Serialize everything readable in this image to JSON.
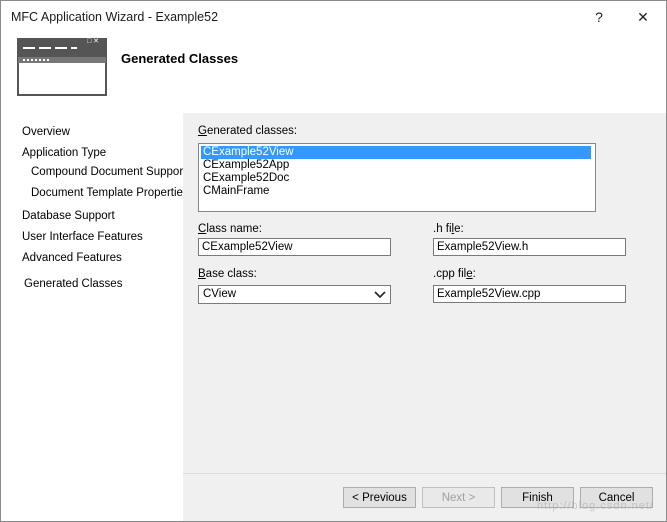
{
  "window": {
    "title": "MFC Application Wizard - Example52",
    "help_glyph": "?",
    "close_glyph": "✕"
  },
  "header": {
    "heading": "Generated Classes",
    "banner_glyph": "□ ✕"
  },
  "nav": {
    "items": [
      "Overview",
      "Application Type",
      "Compound Document Support",
      "Document Template Properties",
      "Database Support",
      "User Interface Features",
      "Advanced Features",
      "Generated Classes"
    ],
    "selected": "Generated Classes"
  },
  "form": {
    "generated_classes_label_u": "G",
    "generated_classes_label_rest": "enerated classes:",
    "classes": [
      "CExample52View",
      "CExample52App",
      "CExample52Doc",
      "CMainFrame"
    ],
    "selected_class": "CExample52View",
    "class_name_label_u": "C",
    "class_name_label_rest": "lass name:",
    "class_name_value": "CExample52View",
    "h_file_label_pre": ".h fi",
    "h_file_label_u": "l",
    "h_file_label_post": "e:",
    "h_file_value": "Example52View.h",
    "base_class_label_u": "B",
    "base_class_label_rest": "ase class:",
    "base_class_value": "CView",
    "cpp_file_label_pre": ".cpp fil",
    "cpp_file_label_u": "e",
    "cpp_file_label_post": ":",
    "cpp_file_value": "Example52View.cpp"
  },
  "buttons": {
    "previous": "< Previous",
    "next": "Next >",
    "finish": "Finish",
    "cancel": "Cancel"
  },
  "watermark": "http://blog.csdn.net/",
  "colors": {
    "selection": "#3399ff",
    "right_pane_bg": "#f0f0f0"
  }
}
